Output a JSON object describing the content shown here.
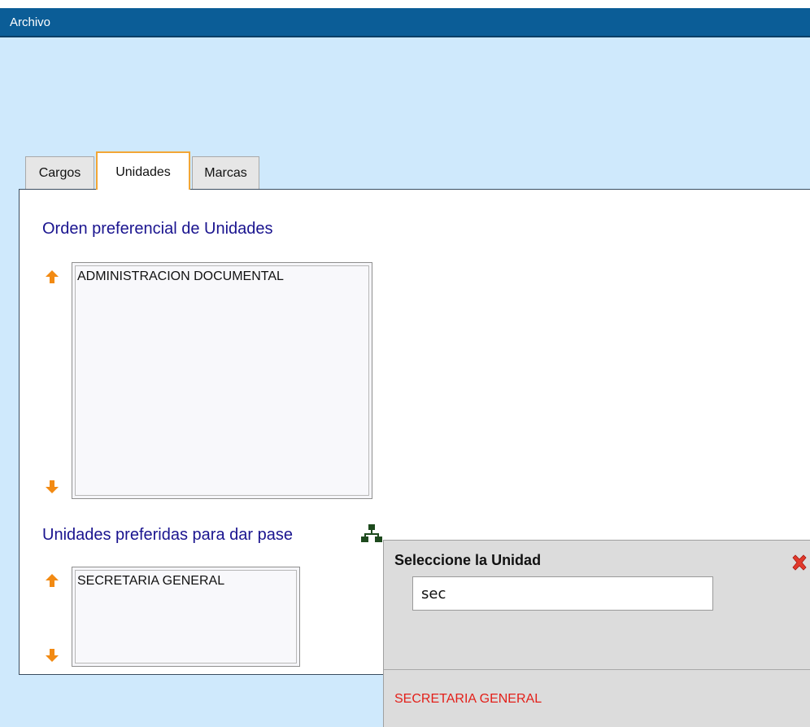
{
  "menubar": {
    "items": [
      "Archivo"
    ]
  },
  "tabs": [
    {
      "label": "Cargos",
      "active": false
    },
    {
      "label": "Unidades",
      "active": true
    },
    {
      "label": "Marcas",
      "active": false
    }
  ],
  "section1": {
    "title": "Orden preferencial de Unidades",
    "items": [
      "ADMINISTRACION DOCUMENTAL"
    ]
  },
  "section2": {
    "title": "Unidades preferidas para dar pase",
    "items": [
      "SECRETARIA GENERAL"
    ]
  },
  "popup": {
    "title": "Seleccione la Unidad",
    "input_value": "sec",
    "results": [
      "SECRETARIA GENERAL"
    ]
  },
  "icons": {
    "move_up": "arrow-up-icon",
    "move_down": "arrow-down-icon",
    "org_tree": "org-chart-icon",
    "close": "close-icon"
  },
  "colors": {
    "menubar": "#0b5d97",
    "page_background": "#cfe9fc",
    "section_title": "#1a148f",
    "arrow": "#f28a13",
    "result_text": "#e3201a",
    "active_tab_border": "#f2a636"
  }
}
